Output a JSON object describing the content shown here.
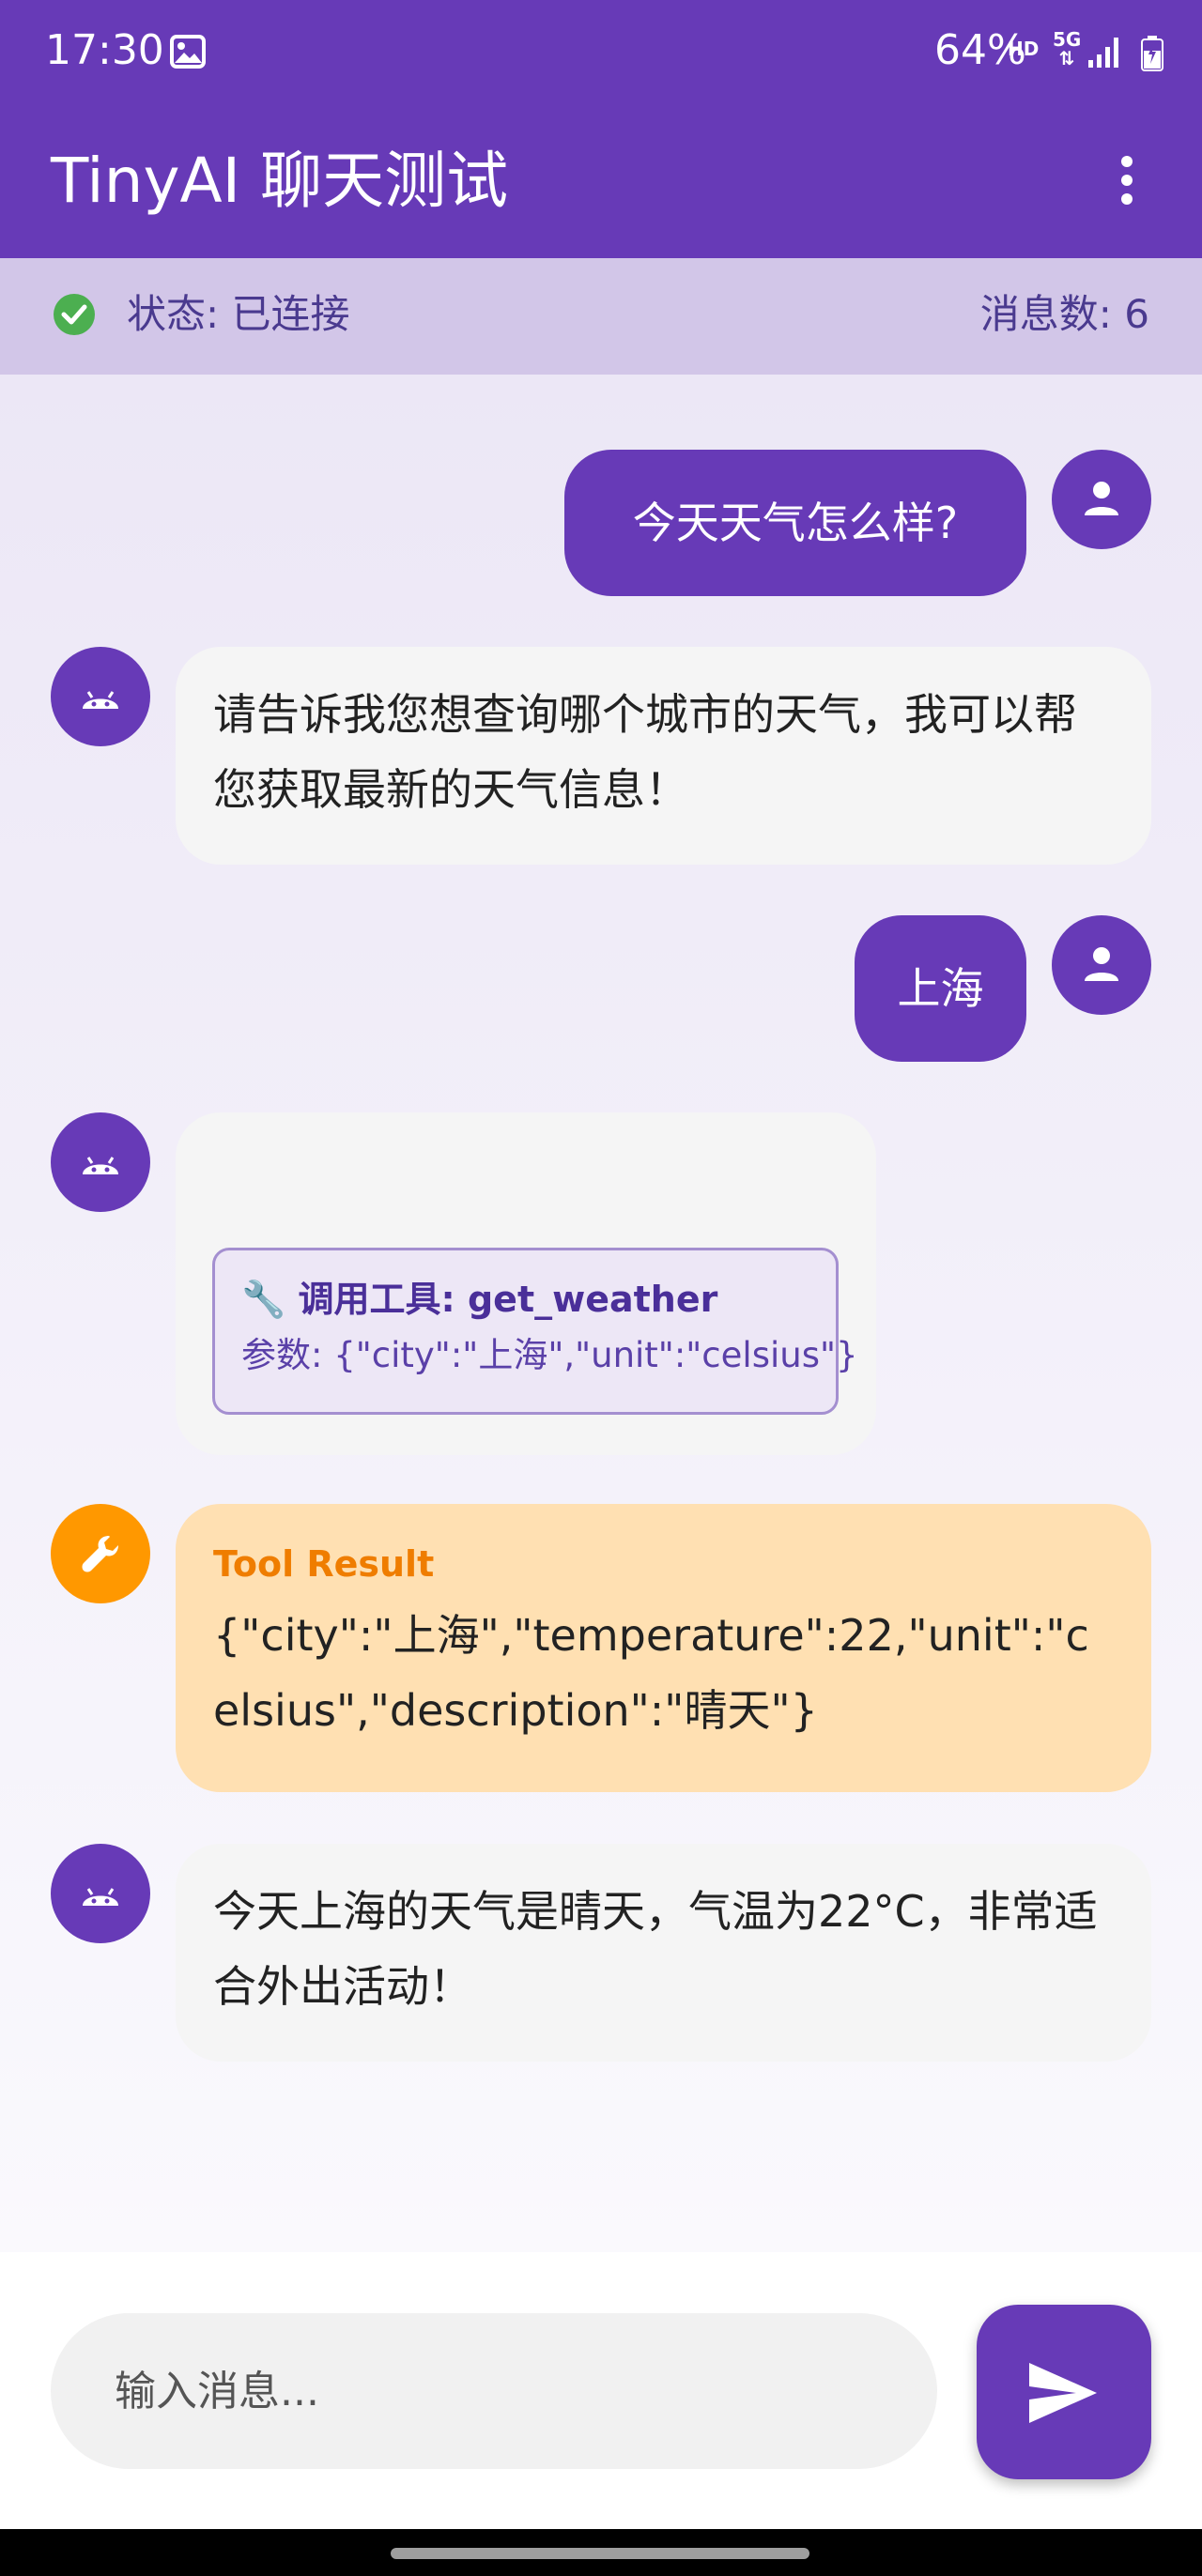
{
  "status_bar": {
    "time": "17:30",
    "hd": "HD",
    "network": "5G",
    "battery": "64%"
  },
  "app_bar": {
    "title": "TinyAI 聊天测试",
    "more_icon": "more-vert-icon"
  },
  "connection": {
    "status_text": "状态: 已连接",
    "message_count_text": "消息数: 6",
    "status_color": "#4caf50"
  },
  "messages": [
    {
      "role": "user",
      "text": "今天天气怎么样?"
    },
    {
      "role": "assistant",
      "text": "请告诉我您想查询哪个城市的天气，我可以帮您获取最新的天气信息！"
    },
    {
      "role": "user",
      "text": "上海"
    },
    {
      "role": "assistant",
      "tool_call": {
        "title": "🔧 调用工具: get_weather",
        "args": "参数: {\"city\":\"上海\",\"unit\":\"celsius\"}"
      }
    },
    {
      "role": "tool",
      "label": "Tool Result",
      "text": "{\"city\":\"上海\",\"temperature\":22,\"unit\":\"celsius\",\"description\":\"晴天\"}"
    },
    {
      "role": "assistant",
      "text": "今天上海的天气是晴天，气温为22°C，非常适合外出活动！"
    }
  ],
  "input": {
    "placeholder": "输入消息...",
    "value": ""
  },
  "colors": {
    "primary": "#673ab7",
    "tool_accent": "#ff9800",
    "tool_bubble": "#ffe0b2"
  }
}
